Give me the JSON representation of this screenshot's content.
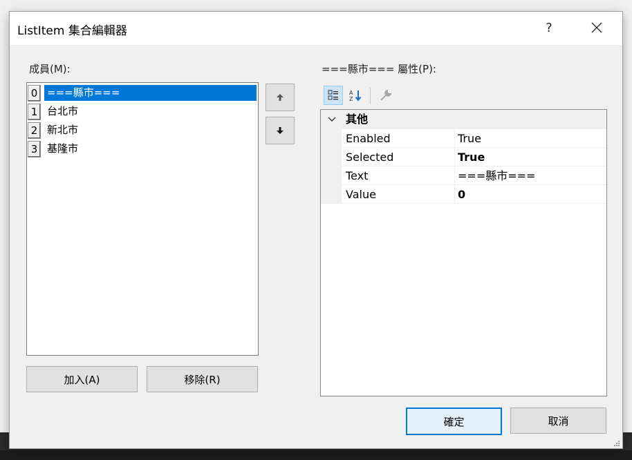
{
  "window": {
    "title": "ListItem 集合編輯器",
    "help_label": "?",
    "close_label": "✕"
  },
  "members": {
    "label": "成員(M):",
    "items": [
      {
        "index": "0",
        "text": "===縣市===",
        "selected": true
      },
      {
        "index": "1",
        "text": "台北市"
      },
      {
        "index": "2",
        "text": "新北市"
      },
      {
        "index": "3",
        "text": "基隆市"
      }
    ],
    "add_label": "加入(A)",
    "remove_label": "移除(R)"
  },
  "properties": {
    "label": "===縣市=== 屬性(P):",
    "category": "其他",
    "rows": [
      {
        "name": "Enabled",
        "value": "True"
      },
      {
        "name": "Selected",
        "value": "True"
      },
      {
        "name": "Text",
        "value": "===縣市==="
      },
      {
        "name": "Value",
        "value": "0"
      }
    ]
  },
  "footer": {
    "ok_label": "確定",
    "cancel_label": "取消"
  },
  "colors": {
    "accent": "#0078d7",
    "selection": "#0078d7"
  }
}
